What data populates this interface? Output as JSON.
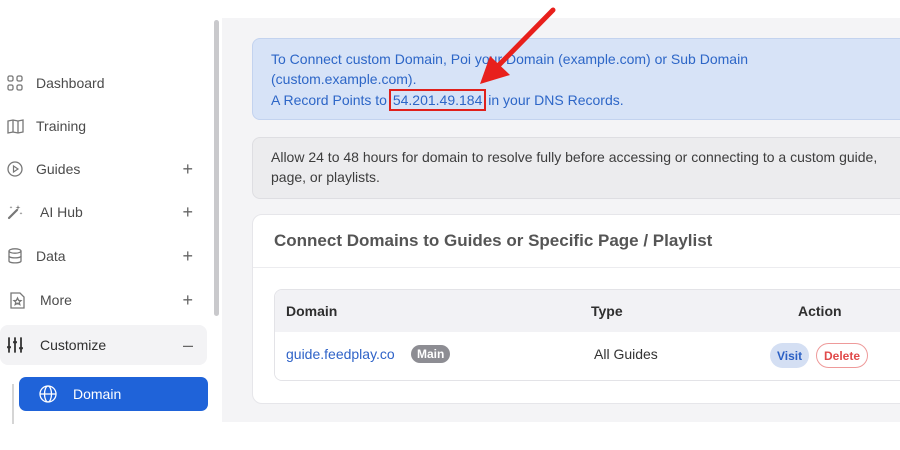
{
  "sidebar": {
    "items": [
      {
        "label": "Dashboard",
        "icon": "grid-icon"
      },
      {
        "label": "Training",
        "icon": "book-icon"
      },
      {
        "label": "Guides",
        "icon": "play-circle-icon",
        "toggle": "+"
      },
      {
        "label": "AI Hub",
        "icon": "magic-wand-icon",
        "toggle": "+"
      },
      {
        "label": "Data",
        "icon": "database-icon",
        "toggle": "+"
      },
      {
        "label": "More",
        "icon": "star-doc-icon",
        "toggle": "+"
      },
      {
        "label": "Customize",
        "icon": "sliders-icon",
        "toggle": "–"
      }
    ],
    "sub_item": {
      "label": "Domain",
      "icon": "globe-icon"
    }
  },
  "info": {
    "line1_pre": "To Connect custom Domain, Poi",
    "line1_post": "your Domain (example.com) or Sub Domain",
    "line2": "(custom.example.com).",
    "line3_pre": "A Record Points to ",
    "ip": "54.201.49.184",
    "line3_post": " in your DNS Records."
  },
  "notice": {
    "text": "Allow 24 to 48 hours for domain to resolve fully before accessing or connecting to a custom guide, page, or playlists."
  },
  "card": {
    "title": "Connect Domains to Guides or Specific Page / Playlist",
    "columns": [
      "Domain",
      "Type",
      "Action"
    ],
    "rows": [
      {
        "domain": "guide.feedplay.co",
        "badge": "Main",
        "type": "All Guides",
        "visit": "Visit",
        "delete": "Delete"
      }
    ]
  },
  "colors": {
    "accent": "#1f63d9",
    "info_bg": "#d7e3f7",
    "highlight": "#e0201b"
  }
}
